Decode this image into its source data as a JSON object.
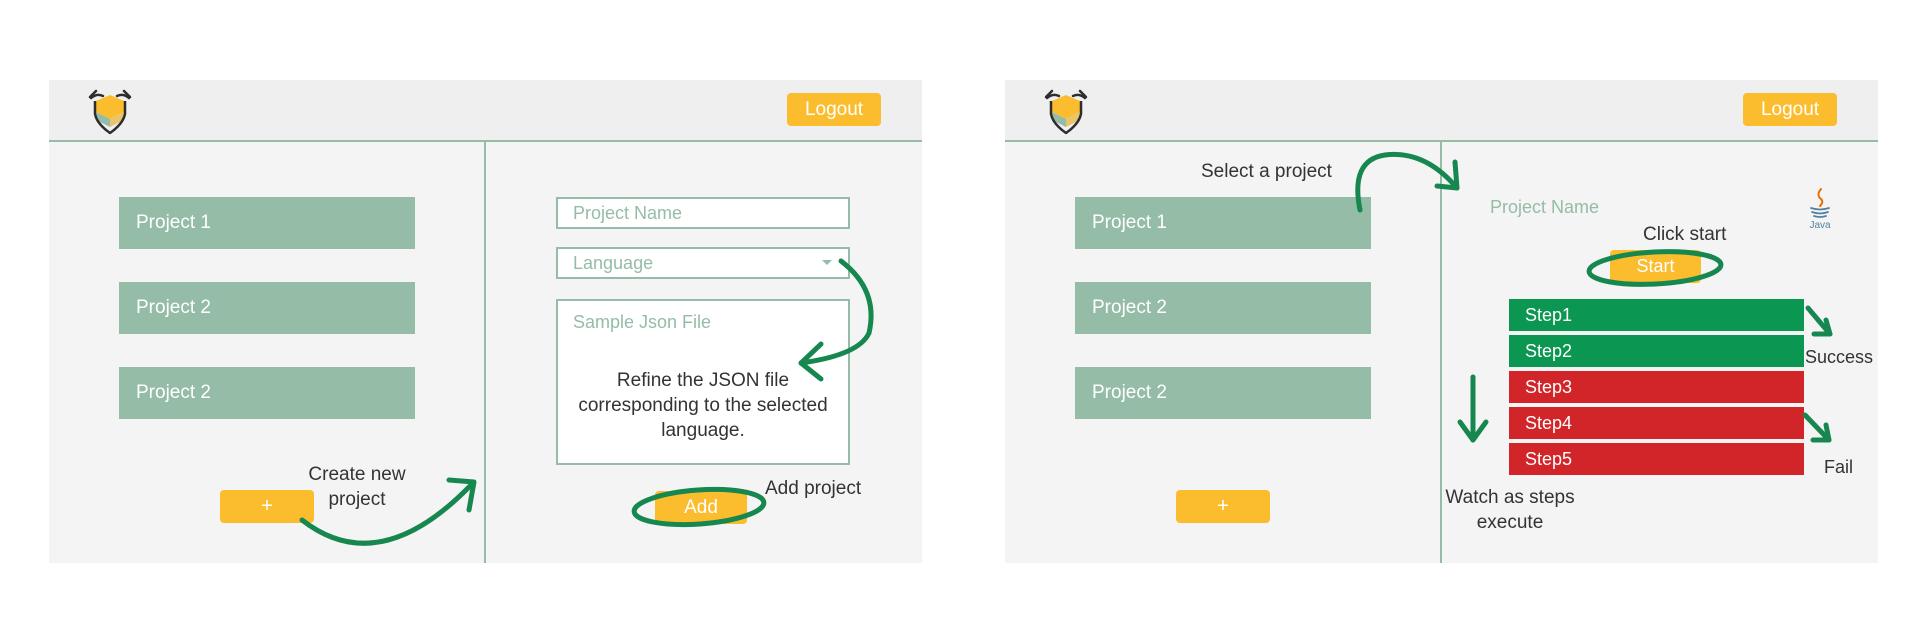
{
  "colors": {
    "accent": "#fbbd2e",
    "project_green": "#95bca7",
    "annotation_green": "#16874f",
    "step_success": "#0b9651",
    "step_fail": "#d12529"
  },
  "icons": [
    "shield-logo-icon",
    "java-icon",
    "dropdown-caret-icon",
    "curved-arrow-icon"
  ],
  "panel_create": {
    "header": {
      "logout_label": "Logout"
    },
    "projects": [
      "Project 1",
      "Project 2",
      "Project 2"
    ],
    "add_button_label": "+",
    "form": {
      "project_name_placeholder": "Project Name",
      "language_placeholder": "Language",
      "json_placeholder": "Sample Json File",
      "json_note": "Refine the JSON file corresponding to the selected language.",
      "add_button_label": "Add"
    },
    "annotations": {
      "create_new_project": "Create new project",
      "add_project": "Add project"
    }
  },
  "panel_run": {
    "header": {
      "logout_label": "Logout"
    },
    "projects": [
      "Project 1",
      "Project 2",
      "Project 2"
    ],
    "add_button_label": "+",
    "project_name_label": "Project Name",
    "java_label": "Java",
    "start_button_label": "Start",
    "steps": [
      {
        "label": "Step1",
        "status": "success"
      },
      {
        "label": "Step2",
        "status": "success"
      },
      {
        "label": "Step3",
        "status": "fail"
      },
      {
        "label": "Step4",
        "status": "fail"
      },
      {
        "label": "Step5",
        "status": "fail"
      }
    ],
    "annotations": {
      "select_project": "Select a project",
      "click_start": "Click start",
      "success": "Success",
      "fail": "Fail",
      "watch_steps": "Watch as steps execute"
    }
  }
}
